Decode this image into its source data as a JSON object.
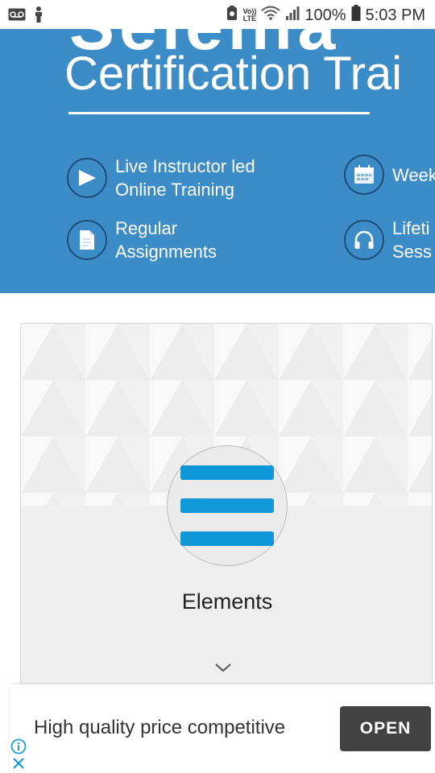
{
  "status_bar": {
    "lte_top": "Vo))",
    "lte_bottom": "LTE",
    "battery": "100%",
    "time": "5:03 PM",
    "icons": [
      "voicemail-icon",
      "accessibility-icon",
      "data-saver-icon",
      "wifi-icon",
      "signal-icon",
      "battery-icon"
    ]
  },
  "hero": {
    "partial_heading": "Selenia",
    "title": "Certification Trai",
    "features": [
      {
        "icon": "play-icon",
        "lines": [
          "Live Instructor led",
          "Online Training"
        ]
      },
      {
        "icon": "calendar-icon",
        "lines": [
          "Week",
          ""
        ]
      },
      {
        "icon": "document-icon",
        "lines": [
          "Regular",
          "Assignments"
        ]
      },
      {
        "icon": "headphones-icon",
        "lines": [
          "Lifeti",
          "Sess"
        ]
      }
    ]
  },
  "card": {
    "icon": "menu-icon",
    "title": "Elements",
    "expand_icon": "chevron-down-icon"
  },
  "ad": {
    "text": "High quality price competitive",
    "button": "OPEN",
    "info_icon": "info-icon",
    "close_icon": "close-icon"
  },
  "colors": {
    "hero_bg": "#3c8cc8",
    "menu_bar": "#0f97d8",
    "ad_button": "#424242"
  }
}
